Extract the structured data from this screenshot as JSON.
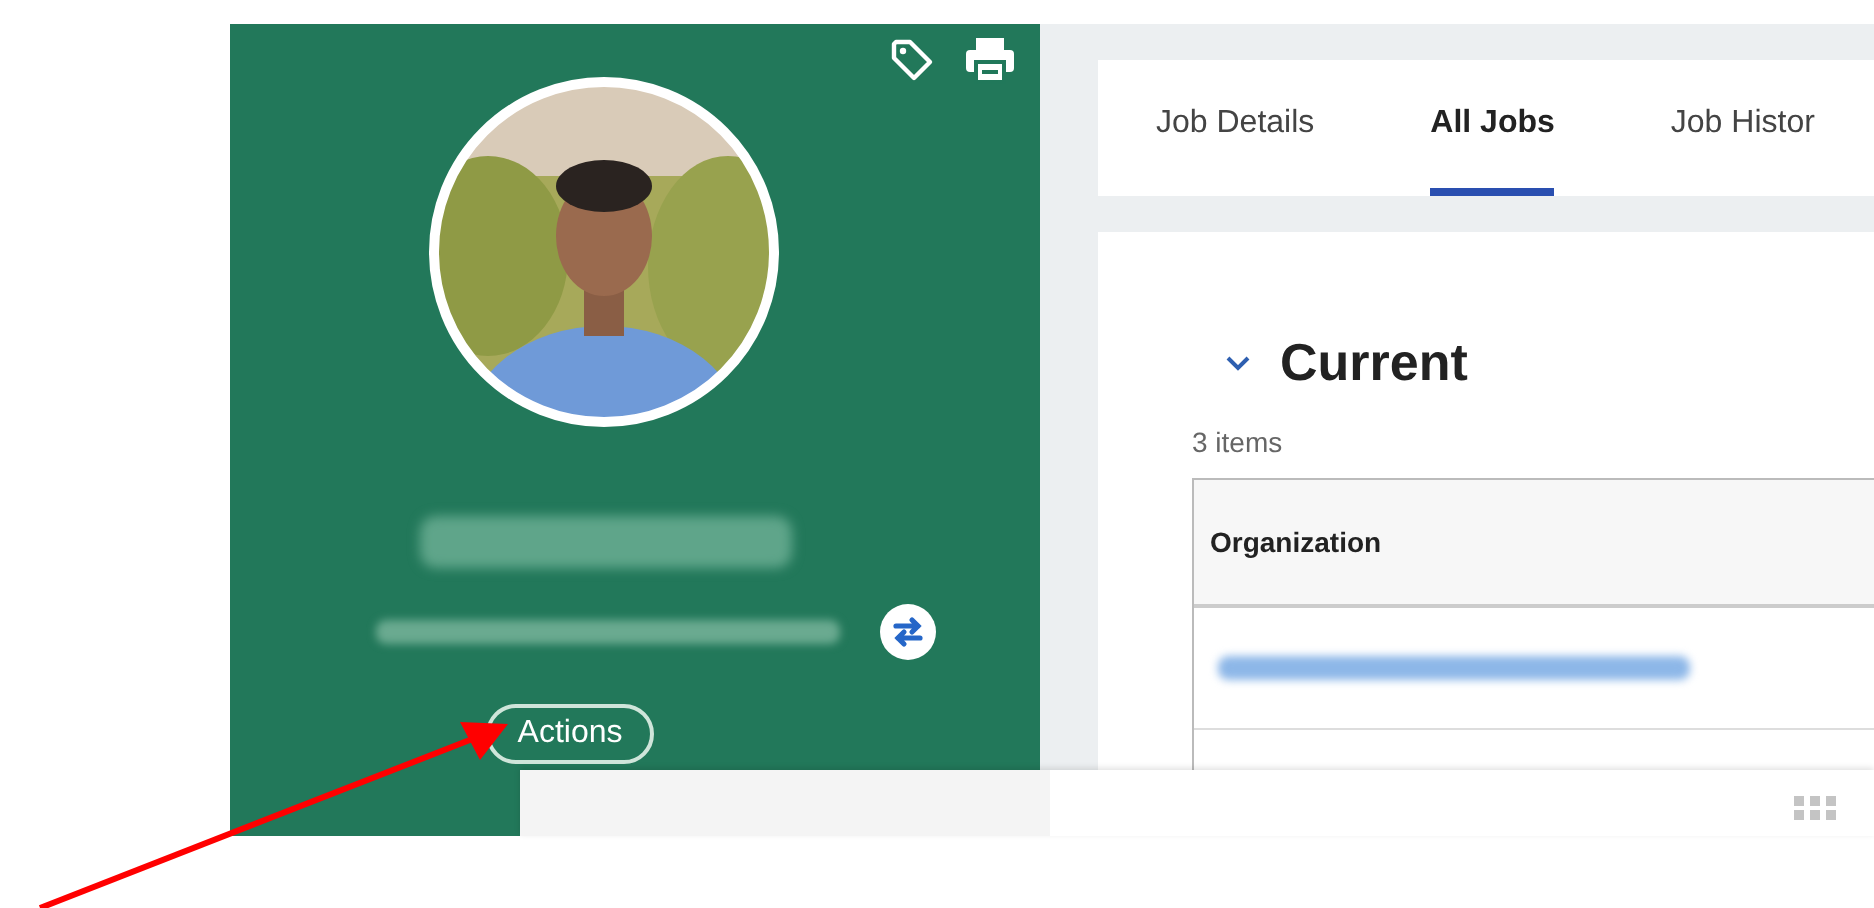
{
  "profile": {
    "actions_button": "Actions"
  },
  "tabs": [
    {
      "label": "Job Details",
      "selected": false
    },
    {
      "label": "All Jobs",
      "selected": true
    },
    {
      "label": "Job Histor",
      "selected": false
    }
  ],
  "section": {
    "title": "Current",
    "expanded": true,
    "count": "3 items"
  },
  "table": {
    "columns": [
      "Organization"
    ]
  }
}
